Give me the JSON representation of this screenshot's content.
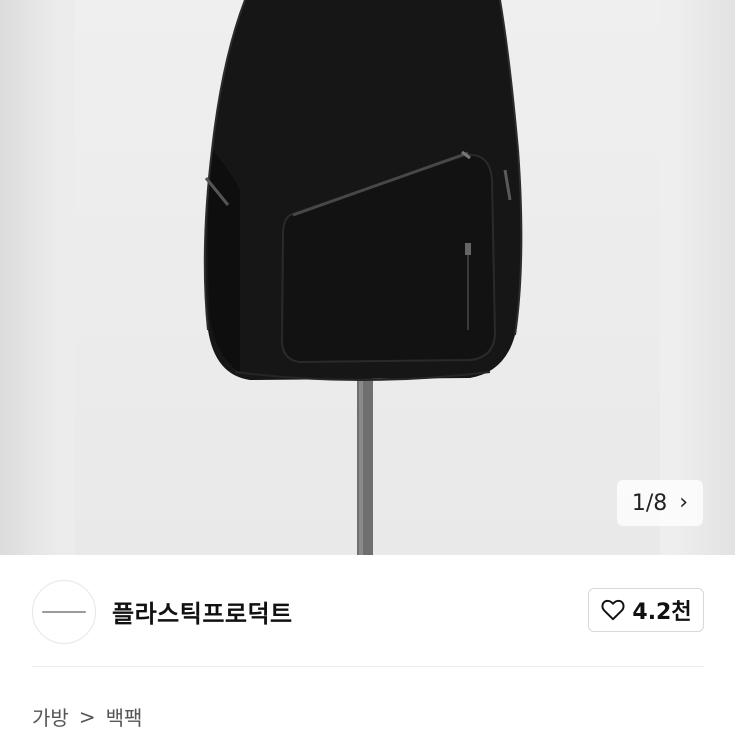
{
  "gallery": {
    "counter": "1/8",
    "next_icon": "chevron-right-icon"
  },
  "seller": {
    "name": "플라스틱프로덕트",
    "like_count": "4.2천",
    "like_icon": "heart-outline-icon"
  },
  "breadcrumb": {
    "items": [
      "가방",
      "백팩"
    ],
    "separator": ">"
  },
  "colors": {
    "accent": "#111111",
    "border": "#d9d9d9"
  }
}
